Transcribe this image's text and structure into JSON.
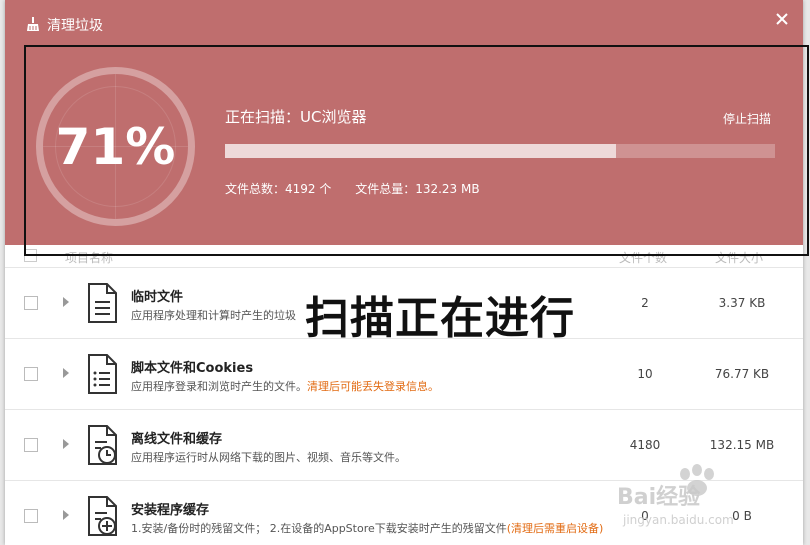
{
  "window": {
    "title": "清理垃圾"
  },
  "scan": {
    "percent_label": "71%",
    "progress": 0.71,
    "status_label": "正在扫描：UC浏览器",
    "stop_label": "停止扫描",
    "file_count_label": "文件总数：4192 个",
    "file_size_label": "文件总量：132.23 MB"
  },
  "table": {
    "headers": {
      "name": "项目名称",
      "count": "文件个数",
      "size": "文件大小"
    },
    "rows": [
      {
        "name": "临时文件",
        "desc": "应用程序处理和计算时产生的垃圾",
        "warn": "",
        "count": "2",
        "size": "3.37 KB",
        "icon": "document-icon"
      },
      {
        "name": "脚本文件和Cookies",
        "desc": "应用程序登录和浏览时产生的文件。",
        "warn": "清理后可能丢失登录信息。",
        "count": "10",
        "size": "76.77 KB",
        "icon": "document-icon"
      },
      {
        "name": "离线文件和缓存",
        "desc": "应用程序运行时从网络下载的图片、视频、音乐等文件。",
        "warn": "",
        "count": "4180",
        "size": "132.15 MB",
        "icon": "document-clock-icon"
      },
      {
        "name": "安装程序缓存",
        "desc": "1.安装/备份时的残留文件； 2.在设备的AppStore下载安装时产生的残留文件",
        "warn": "(清理后需重启设备)",
        "count": "0",
        "size": "0 B",
        "icon": "document-plus-icon"
      }
    ]
  },
  "annotation": {
    "text": "扫描正在进行"
  },
  "watermark": {
    "text": "Bai经验",
    "subtext": "jingyan.baidu.com"
  },
  "colors": {
    "header_bg": "#bf6e6e",
    "warn": "#e26b13"
  }
}
